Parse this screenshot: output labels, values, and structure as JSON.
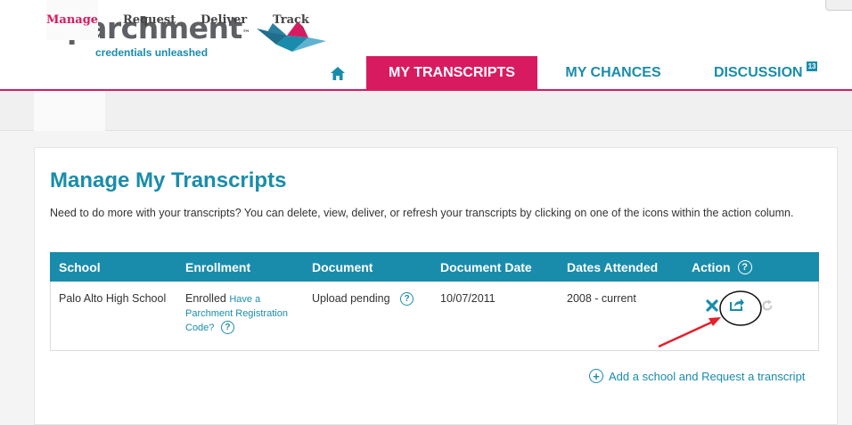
{
  "brand": {
    "name": "parchment",
    "trademark": "™",
    "tagline": "credentials unleashed"
  },
  "nav": {
    "home_icon": "home-icon",
    "tabs": [
      {
        "label": "MY TRANSCRIPTS",
        "active": true
      },
      {
        "label": "MY CHANCES",
        "active": false
      },
      {
        "label": "DISCUSSION",
        "active": false,
        "badge": "13"
      }
    ]
  },
  "subnav": {
    "items": [
      {
        "label": "Manage",
        "active": true
      },
      {
        "label": "Request",
        "active": false
      },
      {
        "label": "Deliver",
        "active": false
      },
      {
        "label": "Track",
        "active": false
      }
    ]
  },
  "main": {
    "title": "Manage My Transcripts",
    "intro": "Need to do more with your transcripts? You can delete, view, deliver, or refresh your transcripts by clicking on one of the icons within the action column.",
    "table": {
      "columns": [
        "School",
        "Enrollment",
        "Document",
        "Document Date",
        "Dates Attended",
        "Action"
      ],
      "action_help": "?",
      "rows": [
        {
          "school": "Palo Alto High School",
          "enrollment": "Enrolled",
          "enrollment_link": "Have a Parchment Registration Code?",
          "enrollment_help": "?",
          "document": "Upload pending",
          "document_help": "?",
          "document_date": "10/07/2011",
          "dates_attended": "2008 - current",
          "actions": [
            "delete-icon",
            "share-icon",
            "refresh-icon"
          ]
        }
      ]
    },
    "add_link": "Add a school and Request a transcript",
    "add_icon": "plus-circle-icon"
  },
  "colors": {
    "brand_teal": "#1a8cab",
    "brand_pink": "#d81b60",
    "annotation_red": "#e4202a"
  }
}
